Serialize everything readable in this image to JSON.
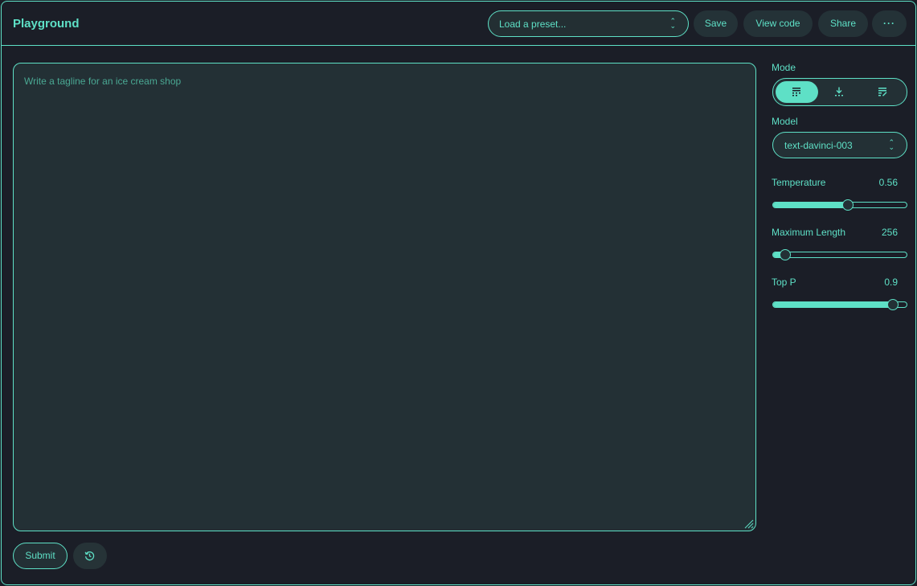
{
  "header": {
    "title": "Playground",
    "preset_placeholder": "Load a preset...",
    "save_label": "Save",
    "view_code_label": "View code",
    "share_label": "Share",
    "more_label": "···"
  },
  "editor": {
    "placeholder": "Write a tagline for an ice cream shop"
  },
  "footer": {
    "submit_label": "Submit",
    "history_icon": "history-icon"
  },
  "sidebar": {
    "mode_label": "Mode",
    "modes": [
      {
        "icon": "complete-icon",
        "active": true
      },
      {
        "icon": "insert-icon",
        "active": false
      },
      {
        "icon": "edit-icon",
        "active": false
      }
    ],
    "model_label": "Model",
    "model_value": "text-davinci-003",
    "temperature": {
      "label": "Temperature",
      "value": "0.56",
      "fraction": 0.56
    },
    "max_length": {
      "label": "Maximum Length",
      "value": "256",
      "fraction": 0.09
    },
    "top_p": {
      "label": "Top P",
      "value": "0.9",
      "fraction": 0.9
    }
  },
  "colors": {
    "accent": "#5ee0c6",
    "background": "#1b1e27",
    "panel": "#233035"
  }
}
